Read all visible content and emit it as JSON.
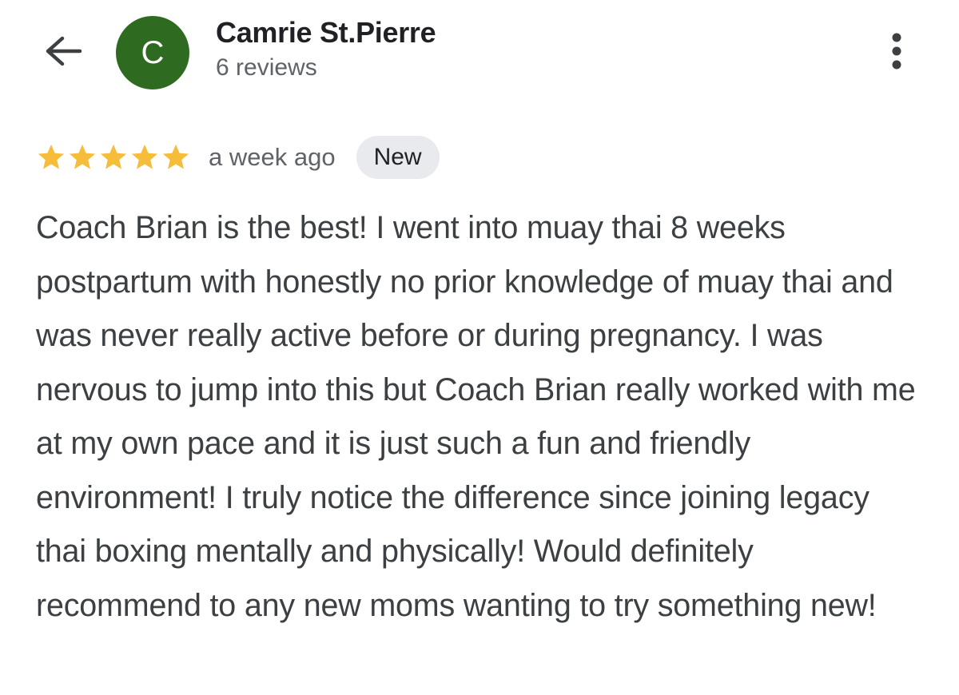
{
  "reviewer": {
    "avatar_letter": "C",
    "name": "Camrie St.Pierre",
    "review_count": "6 reviews"
  },
  "review": {
    "rating": 5,
    "max_rating": 5,
    "date": "a week ago",
    "badge": "New",
    "text": "Coach Brian is the best! I went into muay thai 8 weeks postpartum with honestly no prior knowledge of muay thai and was never really active before or during pregnancy. I was nervous to jump into this but Coach Brian really worked with me at my own pace and it is just such a fun and friendly environment! I truly notice the difference since joining legacy thai boxing mentally and physically! Would definitely recommend to any new moms wanting to try something new!"
  },
  "icons": {
    "back": "arrow-back-icon",
    "more": "more-vertical-icon",
    "star": "star-icon"
  },
  "colors": {
    "avatar_bg": "#2e6b21",
    "star": "#f6bd3b",
    "badge_bg": "#e8eaed",
    "text_primary": "#202124",
    "text_secondary": "#5f6368"
  }
}
